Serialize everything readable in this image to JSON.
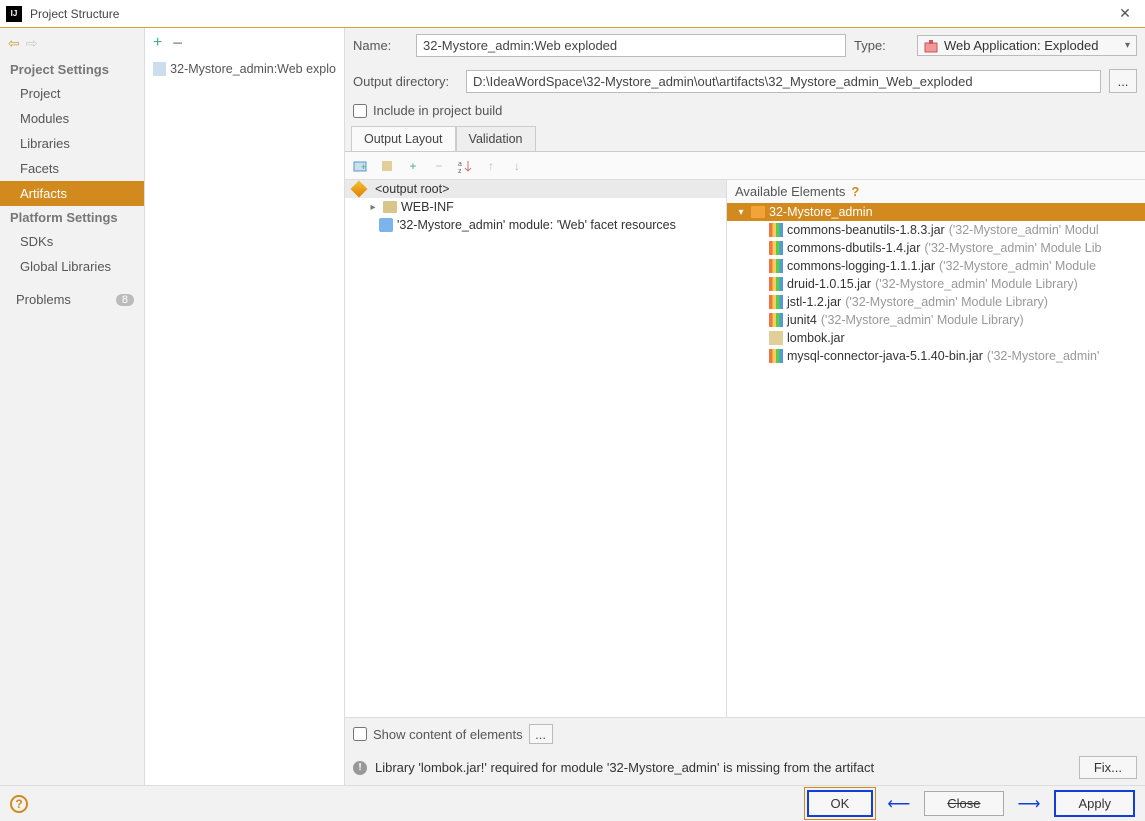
{
  "titlebar": {
    "title": "Project Structure"
  },
  "sidebar": {
    "section1": "Project Settings",
    "items1": [
      "Project",
      "Modules",
      "Libraries",
      "Facets",
      "Artifacts"
    ],
    "section2": "Platform Settings",
    "items2": [
      "SDKs",
      "Global Libraries"
    ],
    "problems": "Problems",
    "problems_count": "8"
  },
  "midlist": {
    "item": "32-Mystore_admin:Web explo"
  },
  "form": {
    "name_label": "Name:",
    "name_value": "32-Mystore_admin:Web exploded",
    "type_label": "Type:",
    "type_value": "Web Application: Exploded",
    "output_label": "Output directory:",
    "output_value": "D:\\IdeaWordSpace\\32-Mystore_admin\\out\\artifacts\\32_Mystore_admin_Web_exploded",
    "include_label": "Include in project build",
    "browse": "..."
  },
  "tabs": {
    "t1": "Output Layout",
    "t2": "Validation"
  },
  "layout": {
    "root": "<output root>",
    "webinf": "WEB-INF",
    "facet": "'32-Mystore_admin' module: 'Web' facet resources"
  },
  "available": {
    "header": "Available Elements",
    "project": "32-Mystore_admin",
    "libs": [
      {
        "name": "commons-beanutils-1.8.3.jar",
        "note": "('32-Mystore_admin' Modul"
      },
      {
        "name": "commons-dbutils-1.4.jar",
        "note": "('32-Mystore_admin' Module Lib"
      },
      {
        "name": "commons-logging-1.1.1.jar",
        "note": "('32-Mystore_admin' Module"
      },
      {
        "name": "druid-1.0.15.jar",
        "note": "('32-Mystore_admin' Module Library)"
      },
      {
        "name": "jstl-1.2.jar",
        "note": "('32-Mystore_admin' Module Library)"
      },
      {
        "name": "junit4",
        "note": "('32-Mystore_admin' Module Library)"
      },
      {
        "name": "lombok.jar",
        "note": "",
        "plain": true
      },
      {
        "name": "mysql-connector-java-5.1.40-bin.jar",
        "note": "('32-Mystore_admin'"
      }
    ]
  },
  "bottom": {
    "show": "Show content of elements",
    "ellipsis": "...",
    "warning": "Library 'lombok.jar!' required for module '32-Mystore_admin' is missing from the artifact",
    "fix": "Fix..."
  },
  "footer": {
    "ok": "OK",
    "close": "Close",
    "apply": "Apply"
  }
}
